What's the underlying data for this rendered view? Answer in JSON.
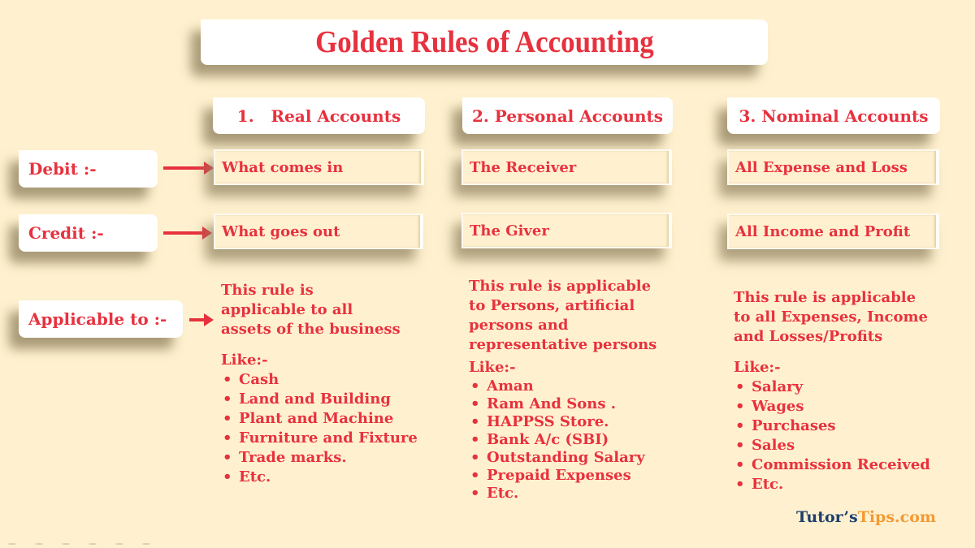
{
  "title": "Golden Rules of Accounting",
  "row_labels": {
    "debit": "Debit :-",
    "credit": "Credit :-",
    "applicable": "Applicable to :-"
  },
  "columns": [
    {
      "heading": "1.   Real Accounts",
      "debit": "What comes in",
      "credit": "What goes out",
      "applicable": "This rule is\napplicable to all\nassets of the business",
      "like_label": "Like:-",
      "examples": [
        "Cash",
        "Land and Building",
        "Plant and Machine",
        "Furniture and Fixture",
        "Trade marks.",
        "Etc."
      ]
    },
    {
      "heading": "2. Personal Accounts",
      "debit": "The Receiver",
      "credit": "The Giver",
      "applicable": "This rule is applicable\nto Persons, artificial\npersons and\nrepresentative persons",
      "like_label": "Like:-",
      "examples": [
        "Aman",
        "Ram And Sons .",
        "HAPPSS Store.",
        "Bank A/c (SBI)",
        "Outstanding Salary",
        "Prepaid Expenses",
        "Etc."
      ]
    },
    {
      "heading": "3. Nominal Accounts",
      "debit": "All Expense and Loss",
      "credit": "All Income and Profit",
      "applicable": "This rule is applicable\nto all Expenses, Income\nand Losses/Profits",
      "like_label": "Like:-",
      "examples": [
        "Salary",
        "Wages",
        "Purchases",
        "Sales",
        "Commission Received",
        "Etc."
      ]
    }
  ],
  "brand": {
    "part1": "Tutor’s",
    "part2": "Tips.com"
  },
  "colors": {
    "background": "#fff1cf",
    "text_red": "#e8313e",
    "brand_navy": "#1f3f6e",
    "brand_orange": "#f39a35"
  }
}
